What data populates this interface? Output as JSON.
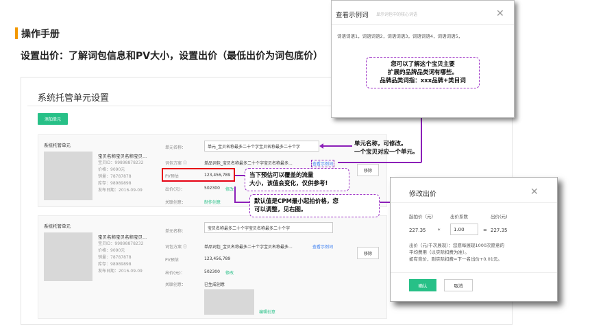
{
  "header": {
    "manual_title": "操作手册",
    "subtitle": "设置出价：了解词包信息和PV大小，设置出价（最低出价为词包底价）"
  },
  "base": {
    "title": "系统托管单元设置",
    "add_button": "添加单元",
    "labels": {
      "unit_name": "单元名称：",
      "keyword_plan": "词包方案",
      "pv": "PV预估",
      "bid": "出价(元)：",
      "creative": "关联创意："
    },
    "cards": [
      {
        "head": "系统托管单元",
        "product_title": "宝贝名称宝贝名称宝贝...",
        "meta": [
          "宝贝ID：99898878232",
          "价格：9090元",
          "销量：78787878",
          "库存：98989898",
          "发布日期：2016-09-09"
        ],
        "unit_name_value": "单元_宝贝名称最多二十个字宝贝名称最多二十个字",
        "keyword_value": "单品词包_宝贝名称最多二十个字宝贝名称最多...",
        "view_examples": "查看示例词",
        "pv_value": "123,456,789",
        "bid_value": "502300",
        "edit_link": "修改",
        "creative_link": "制作创意",
        "remove_button": "移除"
      },
      {
        "head": "系统托管单元",
        "product_title": "宝贝名称宝贝名称宝贝...",
        "meta": [
          "宝贝ID：99898878232",
          "价格：9090元",
          "销量：78787878",
          "库存：98989898",
          "发布日期：2016-09-09"
        ],
        "unit_name_value": "宝贝名称最多二十个字宝贝名称最多二十个字",
        "keyword_value": "单品词包_宝贝名称最多二十个字宝贝名称最多...",
        "view_examples": "查看示例词",
        "pv_value": "123,456,789",
        "bid_value": "502300",
        "edit_link": "修改",
        "creative_value": "已生成创意",
        "edit_creative_link": "编辑创意",
        "remove_button": "移除"
      }
    ]
  },
  "modal_examples": {
    "title": "查看示例词",
    "subtitle": "显示词包中的核心词语",
    "words": "词语词语1，词语词语2，词语词语3，词语词语4，词语词语5，",
    "callout": [
      "您可以了解这个宝贝主要",
      "扩展的品牌品类词有哪些。",
      "品牌品类词指：xxx品牌+类目词"
    ]
  },
  "callouts": {
    "unit_name": [
      "单元名称，可修改。",
      "一个宝贝对应一个单元。"
    ],
    "pv": [
      "当下预估可以覆盖的流量",
      "大小，该值会变化，仅供参考!"
    ],
    "bid": [
      "默认值是CPM最小起拍价格，您",
      "可以调整，见右图。"
    ]
  },
  "modal_bid": {
    "title": "修改出价",
    "col_start": "起拍价（元）",
    "col_coef": "出价系数",
    "col_bid": "出价(元)",
    "start_value": "227.35",
    "multiply": "*",
    "coef_value": "1.00",
    "equals": "=",
    "bid_value": "227.35",
    "note": [
      "出价（元/千次展现）：您愿每展现1000次愿意的",
      "平均费用（以实际扣费为准）。",
      "如有竞价，则实际扣费=下一名出价+0.01元。"
    ],
    "ok": "确认",
    "cancel": "取消"
  },
  "colors": {
    "accent": "#f39800",
    "green": "#27c087",
    "annotation": "#8b1fb8",
    "highlight": "#e60012"
  }
}
